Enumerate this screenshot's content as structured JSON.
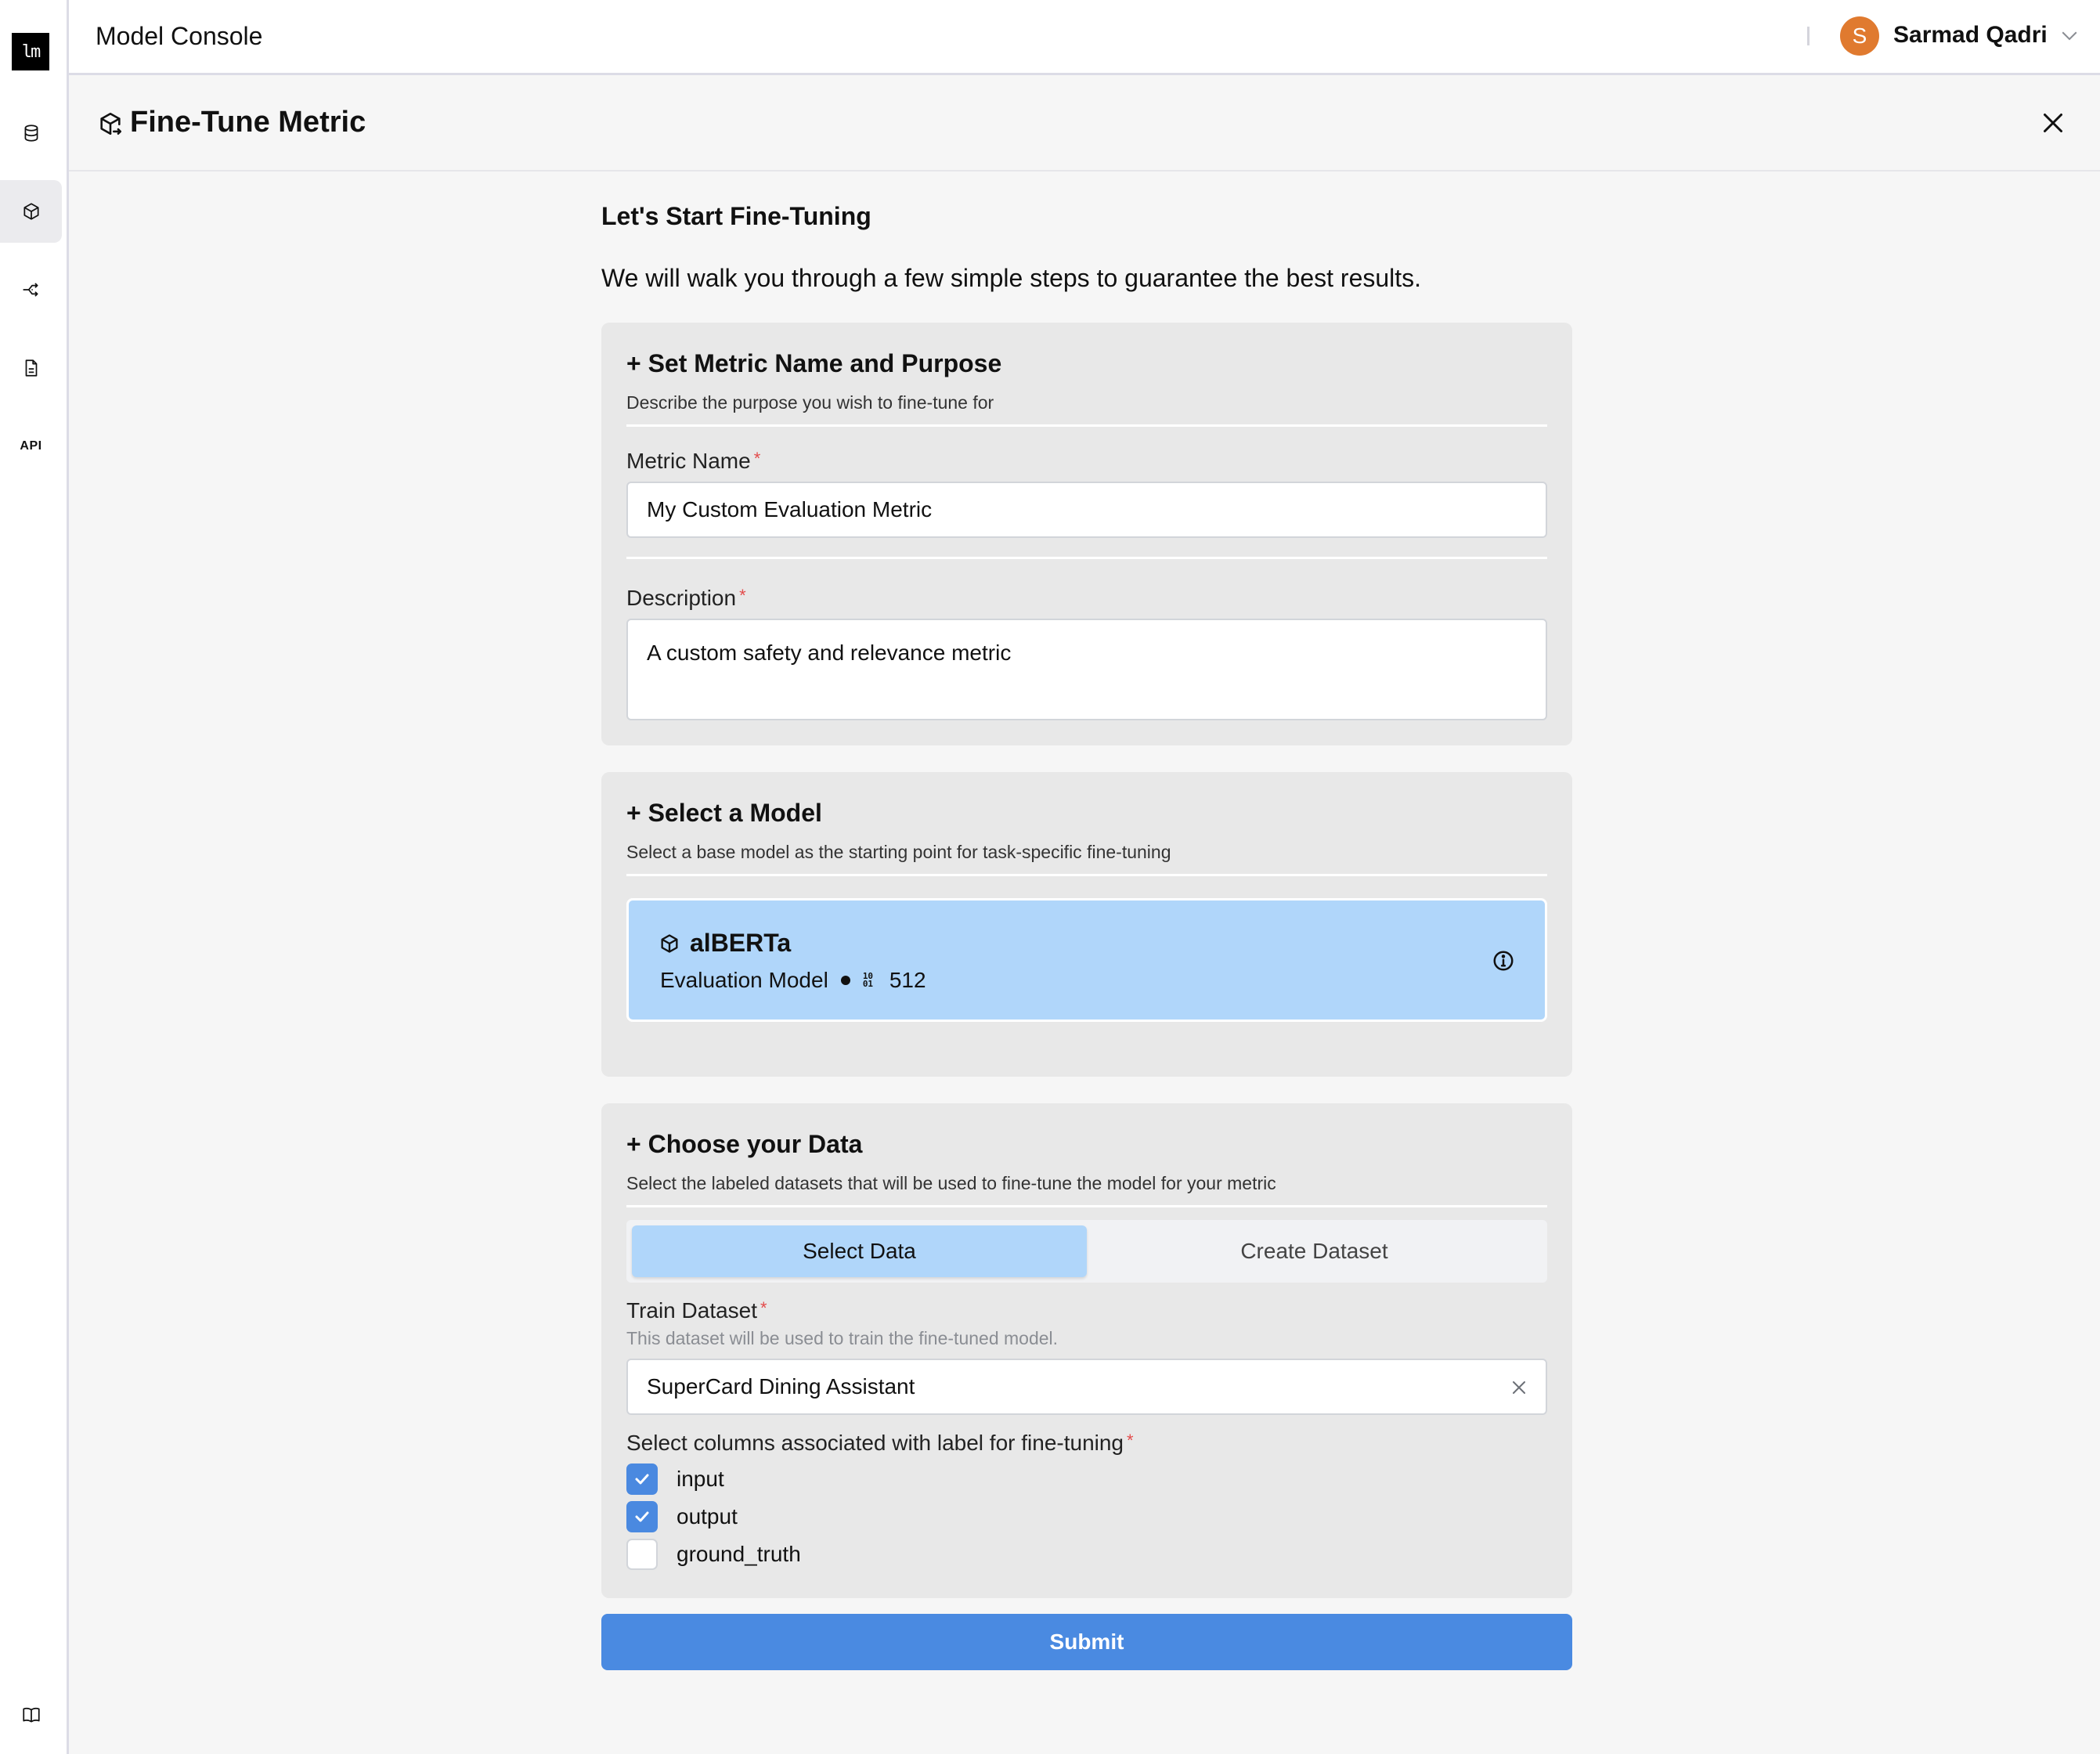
{
  "header": {
    "logo_text": "lm",
    "app_title": "Model Console",
    "user": {
      "avatar_initial": "S",
      "name": "Sarmad Qadri",
      "avatar_color": "#e07a2f"
    }
  },
  "sidebar": {
    "items": [
      {
        "id": "datasets",
        "icon": "database-icon",
        "active": false
      },
      {
        "id": "models",
        "icon": "cube-icon",
        "active": true
      },
      {
        "id": "pipelines",
        "icon": "split-arrow-icon",
        "active": false
      },
      {
        "id": "documents",
        "icon": "document-icon",
        "active": false
      },
      {
        "id": "api",
        "icon": "api-icon",
        "label": "API",
        "active": false
      }
    ],
    "bottom_item": {
      "id": "docs",
      "icon": "book-icon"
    }
  },
  "titlebar": {
    "title": "Fine-Tune Metric"
  },
  "intro": {
    "title": "Let's Start Fine-Tuning",
    "subtitle": "We will walk you through a few simple steps to guarantee the best results."
  },
  "section_metric": {
    "title": "+ Set Metric Name and Purpose",
    "subtitle": "Describe the purpose you wish to fine-tune for",
    "metric_name_label": "Metric Name",
    "metric_name_value": "My Custom Evaluation Metric",
    "description_label": "Description",
    "description_value": "A custom safety and relevance metric",
    "required_mark": "*"
  },
  "section_model": {
    "title": "+ Select a Model",
    "subtitle": "Select a base model as the starting point for task-specific fine-tuning",
    "selected_model": {
      "name": "alBERTa",
      "type": "Evaluation Model",
      "context_size": "512"
    }
  },
  "section_data": {
    "title": "+ Choose your Data",
    "subtitle": "Select the labeled datasets that will be used to fine-tune the model for your metric",
    "tabs": [
      {
        "label": "Select Data",
        "active": true
      },
      {
        "label": "Create Dataset",
        "active": false
      }
    ],
    "train_dataset_label": "Train Dataset",
    "train_dataset_help": "This dataset will be used to train the fine-tuned model.",
    "train_dataset_value": "SuperCard Dining Assistant",
    "columns_label": "Select columns associated with label for fine-tuning",
    "columns": [
      {
        "label": "input",
        "checked": true
      },
      {
        "label": "output",
        "checked": true
      },
      {
        "label": "ground_truth",
        "checked": false
      }
    ],
    "required_mark": "*"
  },
  "actions": {
    "submit_label": "Submit",
    "submit_color": "#4a8ae1"
  },
  "colors": {
    "selected_blue": "#b0d6fa",
    "checkbox_blue": "#4a89e0",
    "required_red": "#e34b4b"
  }
}
